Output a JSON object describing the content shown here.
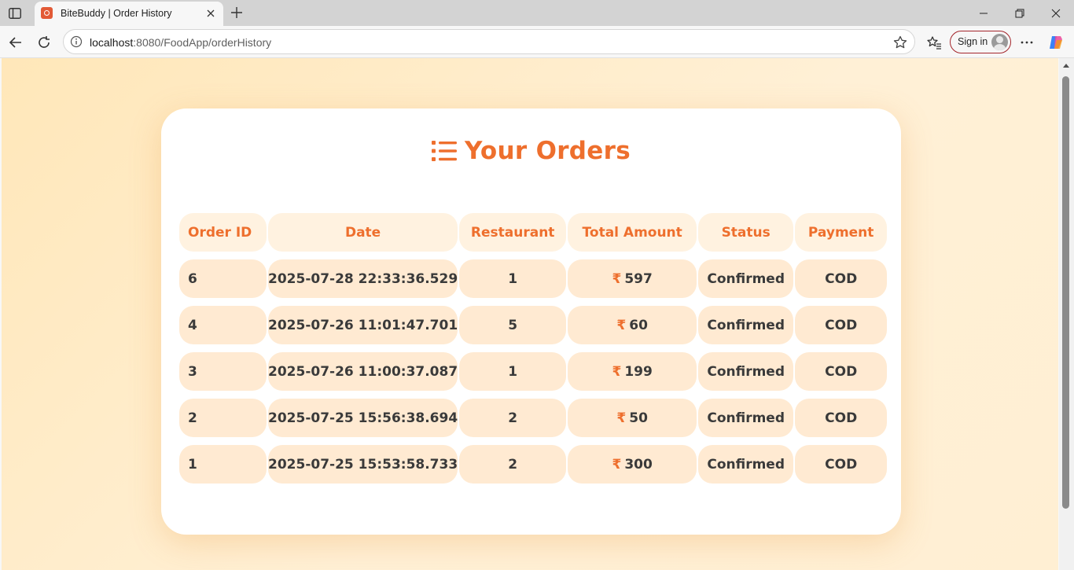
{
  "browser": {
    "tab_title": "BiteBuddy | Order History",
    "url_host": "localhost",
    "url_rest": ":8080/FoodApp/orderHistory",
    "signin_label": "Sign in"
  },
  "page": {
    "heading": "Your Orders",
    "heading_icon": "list-icon",
    "accent_color": "#ee6f2d",
    "currency_symbol": "₹",
    "columns": [
      "Order ID",
      "Date",
      "Restaurant",
      "Total Amount",
      "Status",
      "Payment"
    ],
    "orders": [
      {
        "id": "6",
        "date": "2025-07-28 22:33:36.529",
        "restaurant": "1",
        "amount": "597",
        "status": "Confirmed",
        "payment": "COD"
      },
      {
        "id": "4",
        "date": "2025-07-26 11:01:47.701",
        "restaurant": "5",
        "amount": "60",
        "status": "Confirmed",
        "payment": "COD"
      },
      {
        "id": "3",
        "date": "2025-07-26 11:00:37.087",
        "restaurant": "1",
        "amount": "199",
        "status": "Confirmed",
        "payment": "COD"
      },
      {
        "id": "2",
        "date": "2025-07-25 15:56:38.694",
        "restaurant": "2",
        "amount": "50",
        "status": "Confirmed",
        "payment": "COD"
      },
      {
        "id": "1",
        "date": "2025-07-25 15:53:58.733",
        "restaurant": "2",
        "amount": "300",
        "status": "Confirmed",
        "payment": "COD"
      }
    ]
  }
}
